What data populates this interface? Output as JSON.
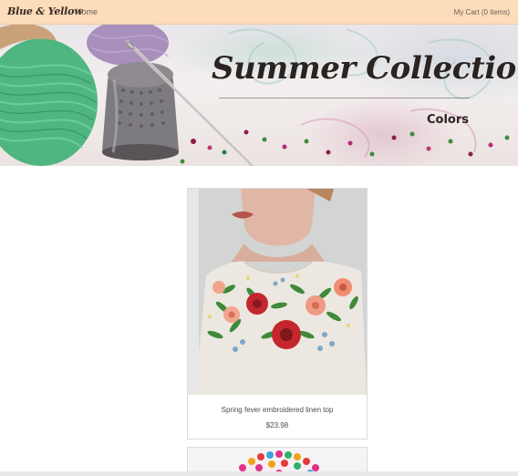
{
  "navbar": {
    "brand": "Blue & Yellow",
    "home_label": "Home",
    "cart_label": "My Cart (0 items)"
  },
  "hero": {
    "title": "Summer Collection",
    "subtitle": "Colors"
  },
  "products": [
    {
      "name": "Spring fever embroidered linen top",
      "price": "$23.98"
    }
  ],
  "colors": {
    "navbar_bg": "#fcdcba",
    "text_dark": "#2b2321"
  }
}
